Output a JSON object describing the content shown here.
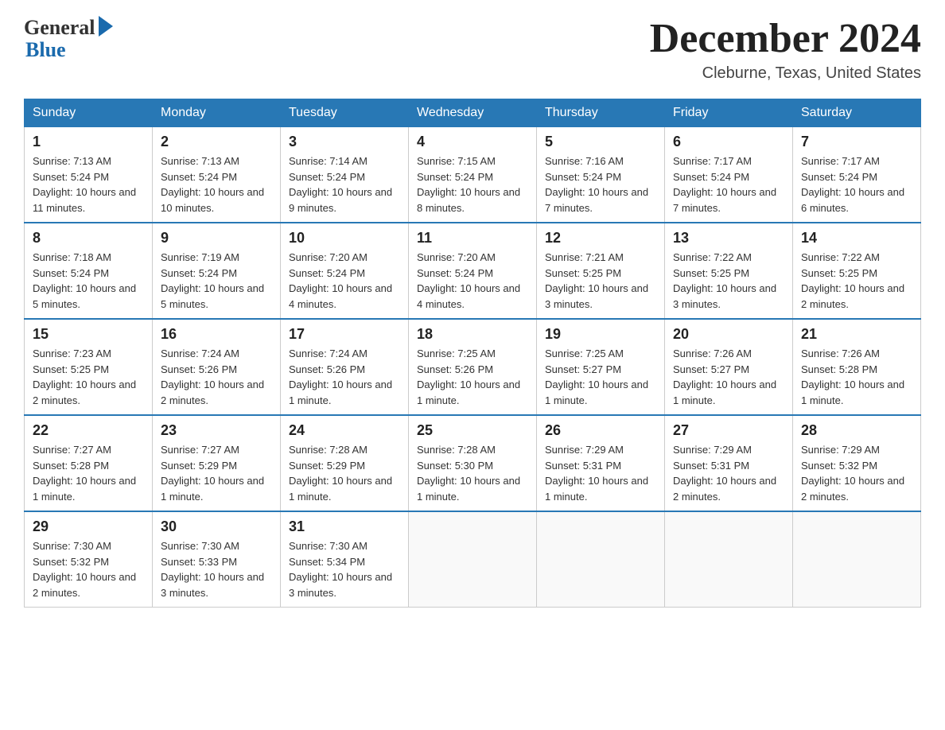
{
  "header": {
    "logo_general": "General",
    "logo_blue": "Blue",
    "month_title": "December 2024",
    "location": "Cleburne, Texas, United States"
  },
  "days_of_week": [
    "Sunday",
    "Monday",
    "Tuesday",
    "Wednesday",
    "Thursday",
    "Friday",
    "Saturday"
  ],
  "weeks": [
    [
      {
        "num": "1",
        "sunrise": "7:13 AM",
        "sunset": "5:24 PM",
        "daylight": "10 hours and 11 minutes."
      },
      {
        "num": "2",
        "sunrise": "7:13 AM",
        "sunset": "5:24 PM",
        "daylight": "10 hours and 10 minutes."
      },
      {
        "num": "3",
        "sunrise": "7:14 AM",
        "sunset": "5:24 PM",
        "daylight": "10 hours and 9 minutes."
      },
      {
        "num": "4",
        "sunrise": "7:15 AM",
        "sunset": "5:24 PM",
        "daylight": "10 hours and 8 minutes."
      },
      {
        "num": "5",
        "sunrise": "7:16 AM",
        "sunset": "5:24 PM",
        "daylight": "10 hours and 7 minutes."
      },
      {
        "num": "6",
        "sunrise": "7:17 AM",
        "sunset": "5:24 PM",
        "daylight": "10 hours and 7 minutes."
      },
      {
        "num": "7",
        "sunrise": "7:17 AM",
        "sunset": "5:24 PM",
        "daylight": "10 hours and 6 minutes."
      }
    ],
    [
      {
        "num": "8",
        "sunrise": "7:18 AM",
        "sunset": "5:24 PM",
        "daylight": "10 hours and 5 minutes."
      },
      {
        "num": "9",
        "sunrise": "7:19 AM",
        "sunset": "5:24 PM",
        "daylight": "10 hours and 5 minutes."
      },
      {
        "num": "10",
        "sunrise": "7:20 AM",
        "sunset": "5:24 PM",
        "daylight": "10 hours and 4 minutes."
      },
      {
        "num": "11",
        "sunrise": "7:20 AM",
        "sunset": "5:24 PM",
        "daylight": "10 hours and 4 minutes."
      },
      {
        "num": "12",
        "sunrise": "7:21 AM",
        "sunset": "5:25 PM",
        "daylight": "10 hours and 3 minutes."
      },
      {
        "num": "13",
        "sunrise": "7:22 AM",
        "sunset": "5:25 PM",
        "daylight": "10 hours and 3 minutes."
      },
      {
        "num": "14",
        "sunrise": "7:22 AM",
        "sunset": "5:25 PM",
        "daylight": "10 hours and 2 minutes."
      }
    ],
    [
      {
        "num": "15",
        "sunrise": "7:23 AM",
        "sunset": "5:25 PM",
        "daylight": "10 hours and 2 minutes."
      },
      {
        "num": "16",
        "sunrise": "7:24 AM",
        "sunset": "5:26 PM",
        "daylight": "10 hours and 2 minutes."
      },
      {
        "num": "17",
        "sunrise": "7:24 AM",
        "sunset": "5:26 PM",
        "daylight": "10 hours and 1 minute."
      },
      {
        "num": "18",
        "sunrise": "7:25 AM",
        "sunset": "5:26 PM",
        "daylight": "10 hours and 1 minute."
      },
      {
        "num": "19",
        "sunrise": "7:25 AM",
        "sunset": "5:27 PM",
        "daylight": "10 hours and 1 minute."
      },
      {
        "num": "20",
        "sunrise": "7:26 AM",
        "sunset": "5:27 PM",
        "daylight": "10 hours and 1 minute."
      },
      {
        "num": "21",
        "sunrise": "7:26 AM",
        "sunset": "5:28 PM",
        "daylight": "10 hours and 1 minute."
      }
    ],
    [
      {
        "num": "22",
        "sunrise": "7:27 AM",
        "sunset": "5:28 PM",
        "daylight": "10 hours and 1 minute."
      },
      {
        "num": "23",
        "sunrise": "7:27 AM",
        "sunset": "5:29 PM",
        "daylight": "10 hours and 1 minute."
      },
      {
        "num": "24",
        "sunrise": "7:28 AM",
        "sunset": "5:29 PM",
        "daylight": "10 hours and 1 minute."
      },
      {
        "num": "25",
        "sunrise": "7:28 AM",
        "sunset": "5:30 PM",
        "daylight": "10 hours and 1 minute."
      },
      {
        "num": "26",
        "sunrise": "7:29 AM",
        "sunset": "5:31 PM",
        "daylight": "10 hours and 1 minute."
      },
      {
        "num": "27",
        "sunrise": "7:29 AM",
        "sunset": "5:31 PM",
        "daylight": "10 hours and 2 minutes."
      },
      {
        "num": "28",
        "sunrise": "7:29 AM",
        "sunset": "5:32 PM",
        "daylight": "10 hours and 2 minutes."
      }
    ],
    [
      {
        "num": "29",
        "sunrise": "7:30 AM",
        "sunset": "5:32 PM",
        "daylight": "10 hours and 2 minutes."
      },
      {
        "num": "30",
        "sunrise": "7:30 AM",
        "sunset": "5:33 PM",
        "daylight": "10 hours and 3 minutes."
      },
      {
        "num": "31",
        "sunrise": "7:30 AM",
        "sunset": "5:34 PM",
        "daylight": "10 hours and 3 minutes."
      },
      null,
      null,
      null,
      null
    ]
  ]
}
